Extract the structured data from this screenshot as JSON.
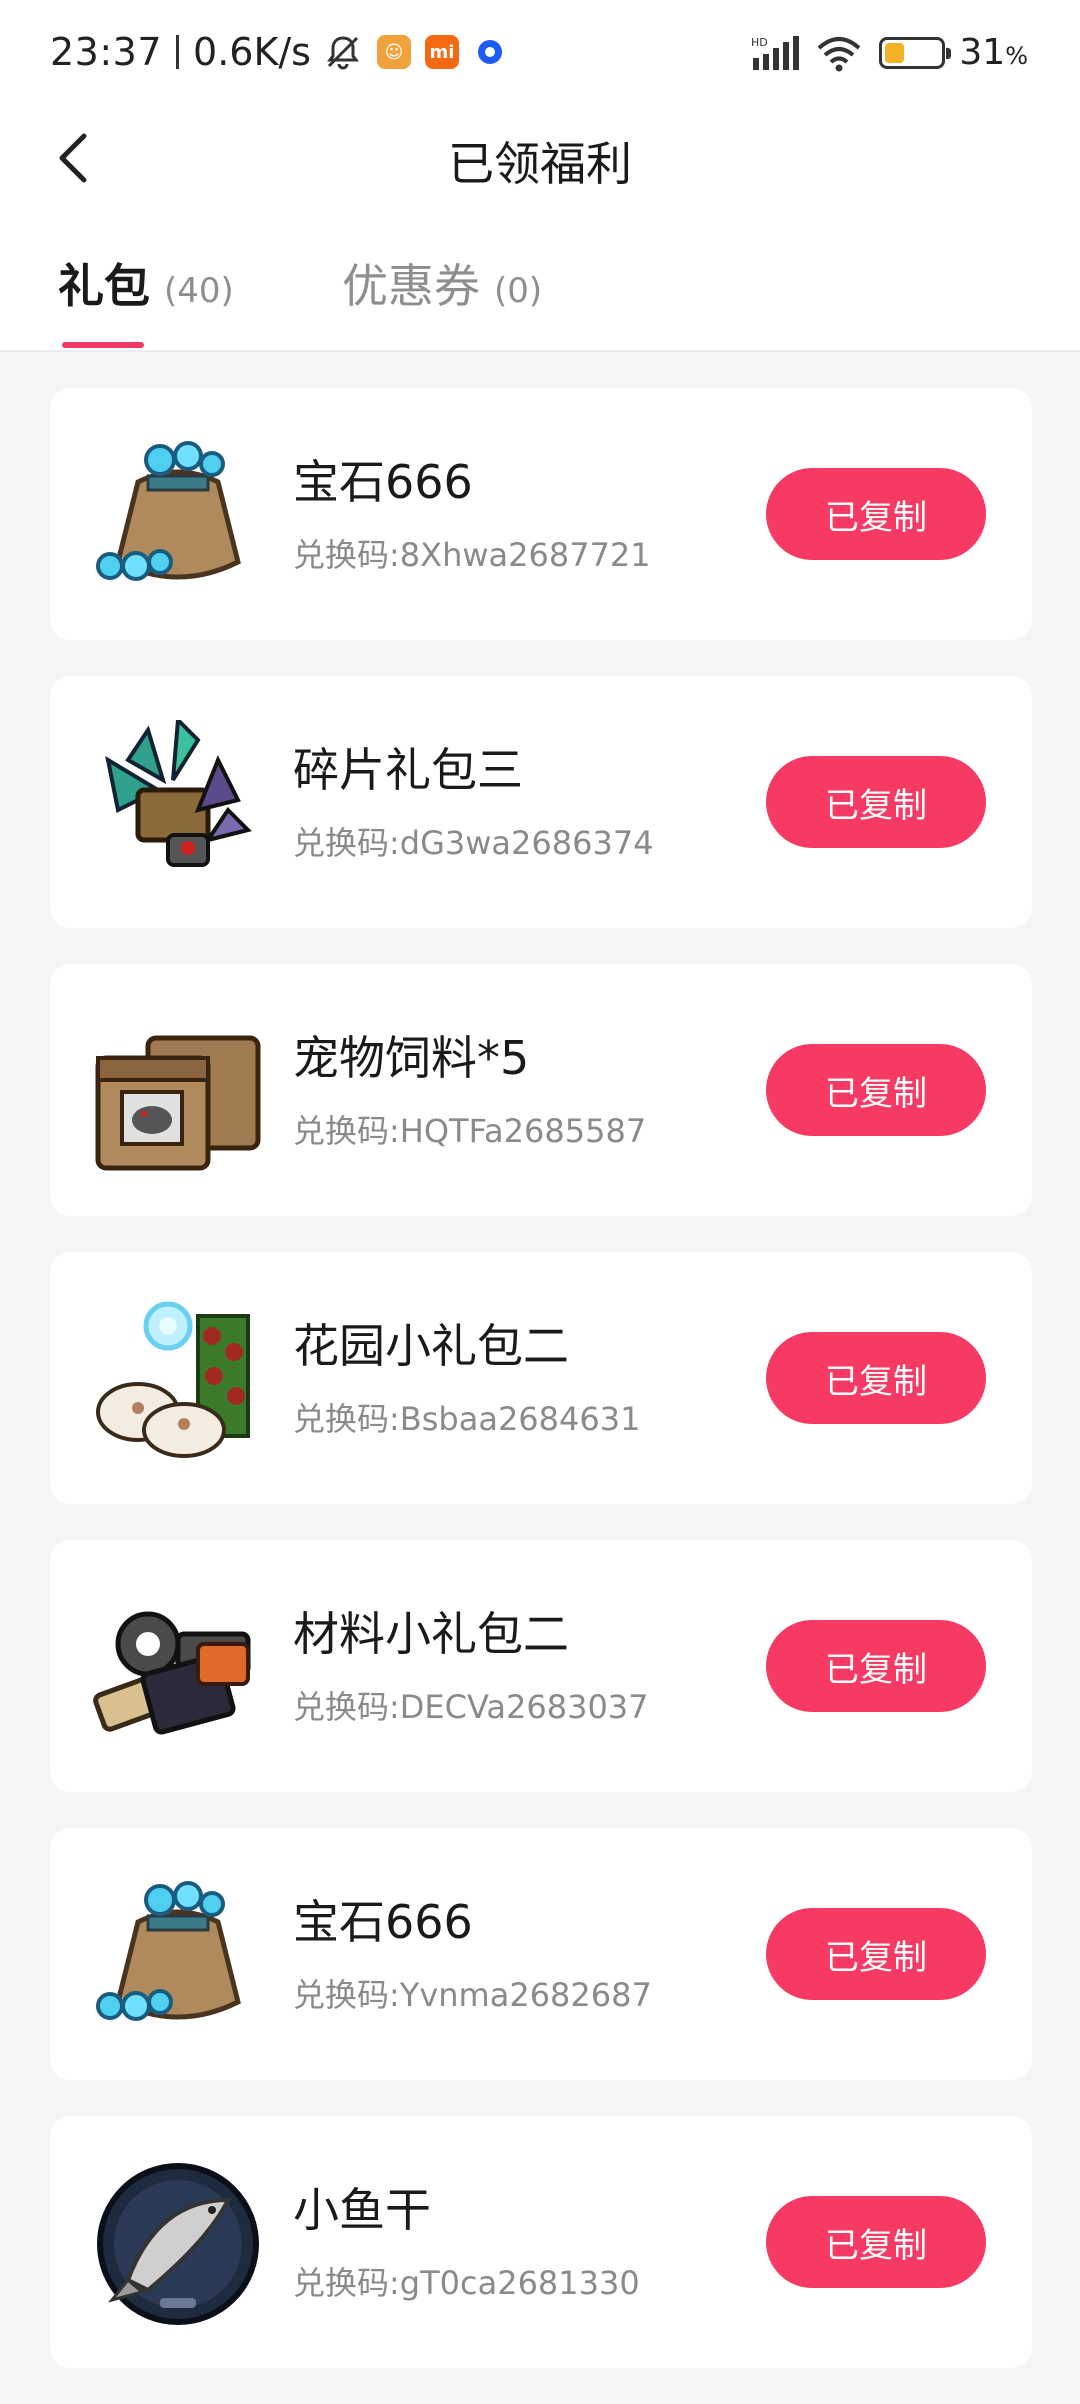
{
  "status_bar": {
    "time": "23:37",
    "net_speed": "0.6K/s",
    "battery_value": "31",
    "battery_unit": "%",
    "battery_level": 0.31
  },
  "header": {
    "title": "已领福利"
  },
  "tabs": [
    {
      "label": "礼包",
      "count": "(40)"
    },
    {
      "label": "优惠券",
      "count": "(0)"
    }
  ],
  "colors": {
    "accent": "#f63a63",
    "background": "#f5f5f7",
    "card": "#ffffff"
  },
  "items": [
    {
      "name": "宝石666",
      "code": "兑换码:8Xhwa2687721",
      "button": "已复制",
      "icon": "gem-bag-icon"
    },
    {
      "name": "碎片礼包三",
      "code": "兑换码:dG3wa2686374",
      "button": "已复制",
      "icon": "shard-pack-icon"
    },
    {
      "name": "宠物饲料*5",
      "code": "兑换码:HQTFa2685587",
      "button": "已复制",
      "icon": "pet-food-sacks-icon"
    },
    {
      "name": "花园小礼包二",
      "code": "兑换码:Bsbaa2684631",
      "button": "已复制",
      "icon": "garden-pack-icon"
    },
    {
      "name": "材料小礼包二",
      "code": "兑换码:DECVa2683037",
      "button": "已复制",
      "icon": "material-pack-icon"
    },
    {
      "name": "宝石666",
      "code": "兑换码:Yvnma2682687",
      "button": "已复制",
      "icon": "gem-bag-icon"
    },
    {
      "name": "小鱼干",
      "code": "兑换码:gT0ca2681330",
      "button": "已复制",
      "icon": "dried-fish-icon"
    }
  ]
}
